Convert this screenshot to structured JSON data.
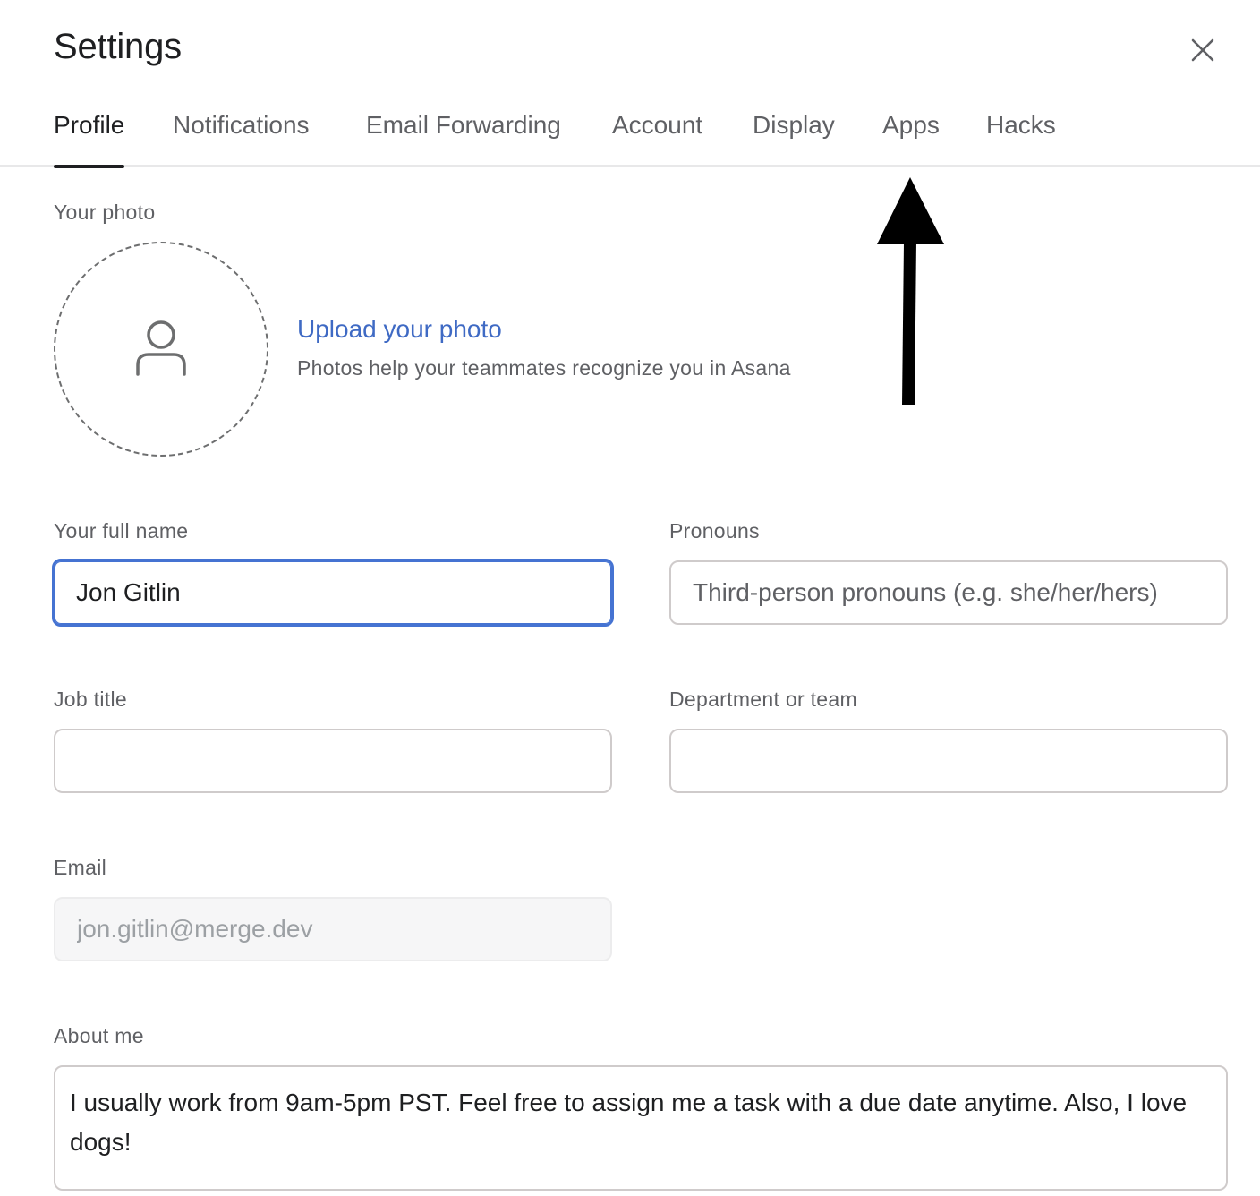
{
  "dialog": {
    "title": "Settings",
    "close_icon": "close-icon"
  },
  "tabs": [
    {
      "label": "Profile",
      "active": true
    },
    {
      "label": "Notifications",
      "active": false
    },
    {
      "label": "Email Forwarding",
      "active": false
    },
    {
      "label": "Account",
      "active": false
    },
    {
      "label": "Display",
      "active": false
    },
    {
      "label": "Apps",
      "active": false
    },
    {
      "label": "Hacks",
      "active": false
    }
  ],
  "photo": {
    "label": "Your photo",
    "avatar_icon": "user-icon",
    "upload_link": "Upload your photo",
    "hint": "Photos help your teammates recognize you in Asana"
  },
  "form": {
    "full_name": {
      "label": "Your full name",
      "value": "Jon Gitlin"
    },
    "pronouns": {
      "label": "Pronouns",
      "placeholder": "Third-person pronouns (e.g. she/her/hers)",
      "value": ""
    },
    "job_title": {
      "label": "Job title",
      "value": ""
    },
    "department": {
      "label": "Department or team",
      "value": ""
    },
    "email": {
      "label": "Email",
      "value": "jon.gitlin@merge.dev"
    },
    "about": {
      "label": "About me",
      "value": "I usually work from 9am-5pm PST. Feel free to assign me a task with a due date anytime. Also, I love dogs!"
    }
  },
  "colors": {
    "accent": "#4573d2",
    "link": "#3f6ac4",
    "text": "#1e1f21",
    "muted": "#5f6064"
  }
}
